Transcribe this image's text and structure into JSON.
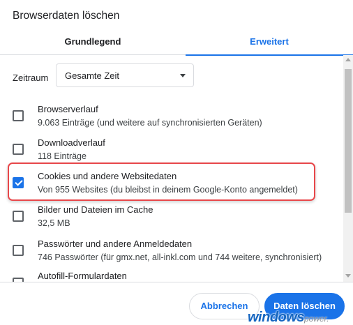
{
  "dialog": {
    "title": "Browserdaten löschen"
  },
  "tabs": [
    {
      "label": "Grundlegend",
      "active": false
    },
    {
      "label": "Erweitert",
      "active": true
    }
  ],
  "time_range": {
    "label": "Zeitraum",
    "selected": "Gesamte Zeit"
  },
  "items": [
    {
      "title": "Browserverlauf",
      "subtitle": "9.063 Einträge (und weitere auf synchronisierten Geräten)",
      "checked": false
    },
    {
      "title": "Downloadverlauf",
      "subtitle": "118 Einträge",
      "checked": false
    },
    {
      "title": "Cookies und andere Websitedaten",
      "subtitle": "Von 955 Websites (du bleibst in deinem Google-Konto angemeldet)",
      "checked": true
    },
    {
      "title": "Bilder und Dateien im Cache",
      "subtitle": "32,5 MB",
      "checked": false
    },
    {
      "title": "Passwörter und andere Anmeldedaten",
      "subtitle": "746 Passwörter (für gmx.net, all-inkl.com und 744 weitere, synchronisiert)",
      "checked": false
    },
    {
      "title": "Autofill-Formulardaten",
      "subtitle": "",
      "checked": false
    }
  ],
  "footer": {
    "cancel_label": "Abbrechen",
    "confirm_label": "Daten löschen"
  },
  "watermark": {
    "main": "windows",
    "sub": "power."
  },
  "colors": {
    "accent": "#1a73e8",
    "highlight": "#e8474a"
  }
}
